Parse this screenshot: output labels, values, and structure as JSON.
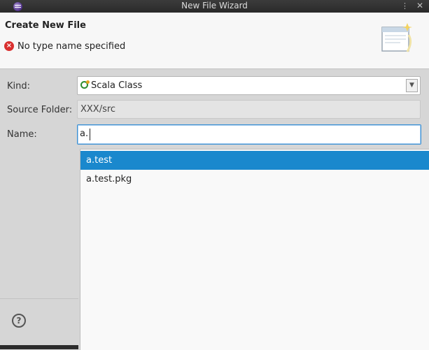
{
  "window": {
    "title": "New File Wizard",
    "menu_glyph": "⋮",
    "close_glyph": "✕"
  },
  "header": {
    "heading": "Create New File",
    "error_message": "No type name specified",
    "error_glyph": "×"
  },
  "form": {
    "kind_label": "Kind:",
    "kind_value": "Scala Class",
    "source_folder_label": "Source Folder:",
    "source_folder_value": "XXX/src",
    "name_label": "Name:",
    "name_value": "a."
  },
  "autocomplete": {
    "items": [
      {
        "label": "a.test",
        "selected": true
      },
      {
        "label": "a.test.pkg",
        "selected": false
      }
    ]
  },
  "footer": {
    "help_glyph": "?"
  },
  "icons": {
    "app": "eclipse-icon",
    "error": "error-icon",
    "kind": "scala-class-icon",
    "banner": "new-file-wizard-banner-icon",
    "help": "help-icon"
  },
  "colors": {
    "selection": "#1a88cd",
    "error": "#d9302f",
    "focus_border": "#3b91d4"
  }
}
